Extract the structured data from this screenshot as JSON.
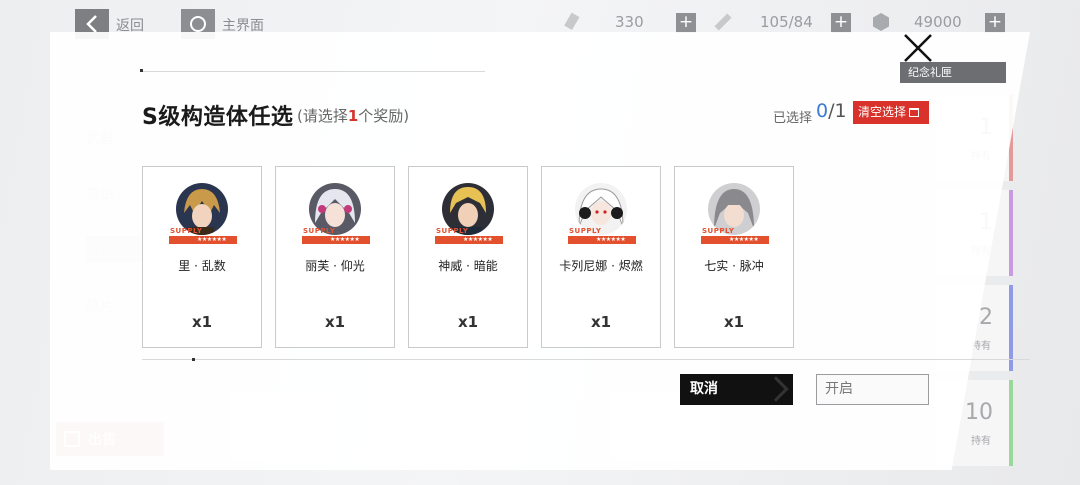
{
  "topbar": {
    "back_label": "返回",
    "home_label": "主界面",
    "resources": [
      {
        "icon": "blackcard-icon",
        "value": "330"
      },
      {
        "icon": "stamina-icon",
        "value": "105/84"
      },
      {
        "icon": "coin-icon",
        "value": "49000"
      }
    ]
  },
  "background": {
    "side_menu": [
      "武器",
      "意识",
      "道具",
      "碎片"
    ],
    "memorial_label": "纪念礼匣",
    "right_cards": [
      {
        "count": "1",
        "caption": "持有",
        "color": "#e59a9a"
      },
      {
        "count": "1",
        "caption": "持有",
        "color": "#c79be0"
      },
      {
        "count": "2",
        "caption": "持有",
        "color": "#8f9be6"
      },
      {
        "count": "10",
        "caption": "持有",
        "color": "#9ad79a"
      }
    ],
    "sell_label": "出售"
  },
  "modal": {
    "title": "S级构造体任选",
    "subtitle_prefix": "(请选择",
    "subtitle_count": "1",
    "subtitle_suffix": "个奖励)",
    "selected_label": "已选择",
    "selected_current": "0",
    "selected_total": "/1",
    "clear_label": "清空选择",
    "supply_text": "SUPPLY",
    "stars": "★★★★★★",
    "cards": [
      {
        "name": "里 · 乱数",
        "qty": "x1"
      },
      {
        "name": "丽芙 · 仰光",
        "qty": "x1"
      },
      {
        "name": "神威 · 暗能",
        "qty": "x1"
      },
      {
        "name": "卡列尼娜 · 烬燃",
        "qty": "x1"
      },
      {
        "name": "七实 · 脉冲",
        "qty": "x1"
      }
    ],
    "cancel_label": "取消",
    "open_label": "开启"
  },
  "colors": {
    "accent_red": "#d8322b",
    "accent_blue": "#3b7bd1",
    "supply_orange": "#e2502e"
  }
}
